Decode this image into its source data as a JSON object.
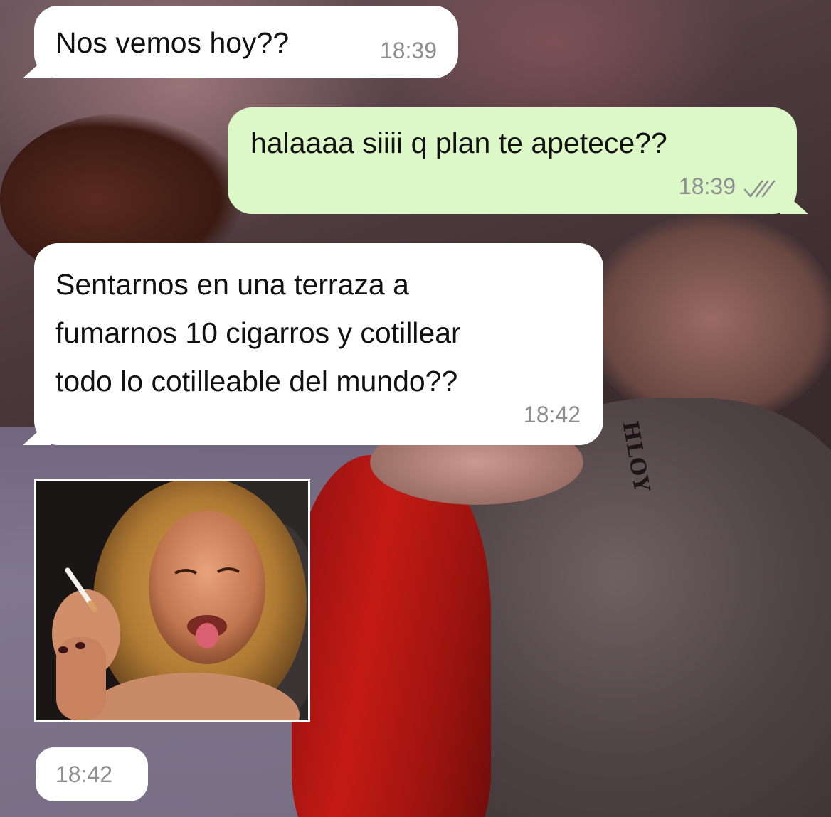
{
  "chat": {
    "messages": [
      {
        "direction": "incoming",
        "text": "Nos vemos hoy??",
        "time": "18:39"
      },
      {
        "direction": "outgoing",
        "text": "halaaaa siiii q plan te apetece??",
        "time": "18:39",
        "status_icon": "double-check-read-icon"
      },
      {
        "direction": "incoming",
        "lines": [
          "Sentarnos en una terraza a",
          "fumarnos 10 cigarros y cotillear",
          "todo lo cotilleable del mundo??"
        ],
        "time": "18:42"
      },
      {
        "direction": "incoming",
        "type": "image",
        "image_desc_icon": "photo-woman-smoking",
        "time": "18:42"
      }
    ]
  },
  "wallpaper": {
    "tattoo_text": "HLOY"
  },
  "colors": {
    "incoming_bubble": "#ffffff",
    "outgoing_bubble": "#dcf8c6",
    "timestamp": "#8e8e93",
    "text": "#111111"
  }
}
